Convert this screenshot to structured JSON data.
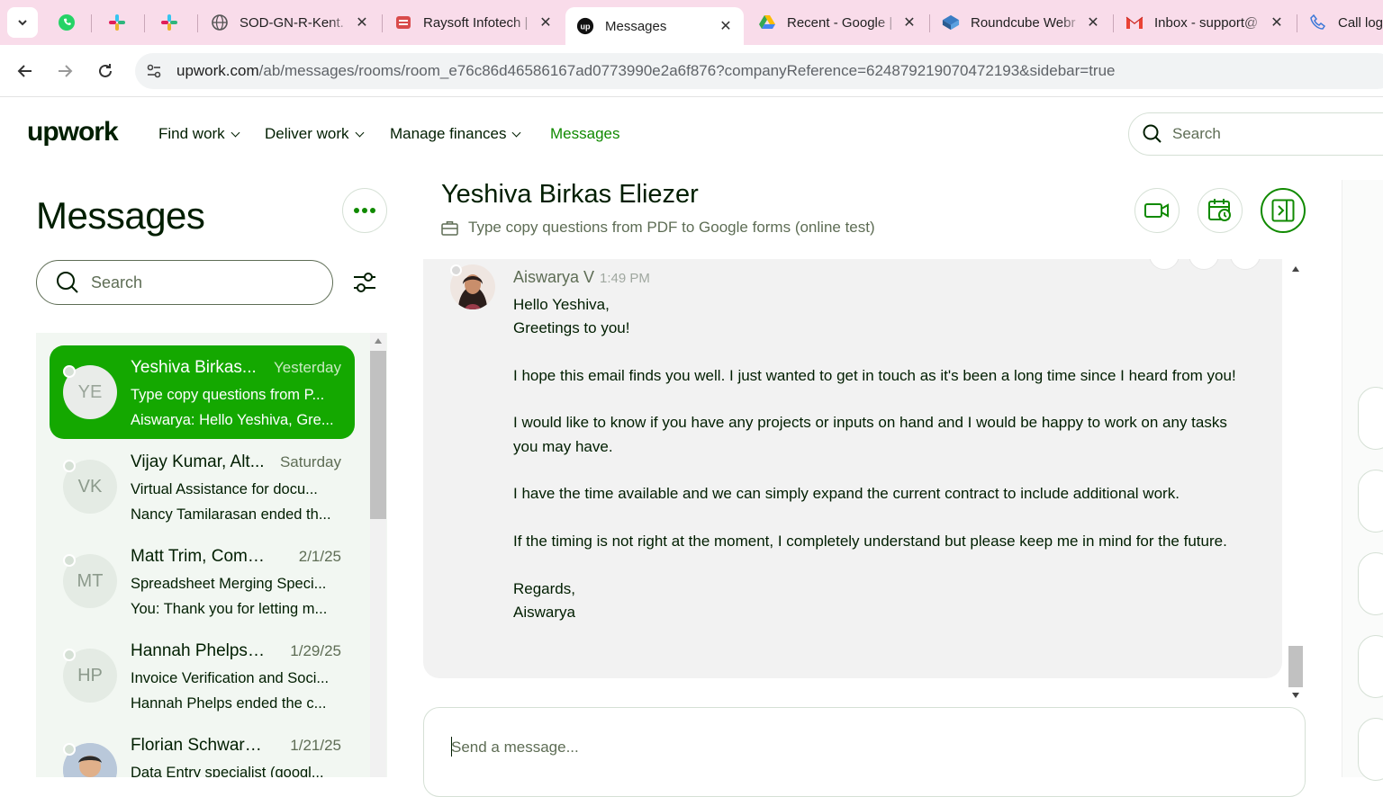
{
  "browser": {
    "tabs": [
      {
        "title": "",
        "icon": "whatsapp-icon"
      },
      {
        "title": "",
        "icon": "slack-icon"
      },
      {
        "title": "",
        "icon": "slack-icon"
      },
      {
        "title": "SOD-GN-R-Kent.",
        "icon": "globe-icon"
      },
      {
        "title": "Raysoft Infotech |",
        "icon": "raysoft-icon"
      },
      {
        "title": "Messages",
        "icon": "upwork-icon"
      },
      {
        "title": "Recent - Google |",
        "icon": "google-drive-icon"
      },
      {
        "title": "Roundcube Webr",
        "icon": "roundcube-icon"
      },
      {
        "title": "Inbox - support@",
        "icon": "gmail-icon"
      },
      {
        "title": "Call log",
        "icon": "phone-icon"
      }
    ],
    "url_host": "upwork.com",
    "url_path": "/ab/messages/rooms/room_e76c86d46586167ad0773990e2a6f876?companyReference=624879219070472193&sidebar=true",
    "tab_close": "✕"
  },
  "header": {
    "logo": "upwork",
    "nav": [
      {
        "label": "Find work",
        "dropdown": true
      },
      {
        "label": "Deliver work",
        "dropdown": true
      },
      {
        "label": "Manage finances",
        "dropdown": true
      },
      {
        "label": "Messages",
        "dropdown": false
      }
    ],
    "search_placeholder": "Search"
  },
  "sidebar": {
    "title": "Messages",
    "search_placeholder": "Search",
    "rooms": [
      {
        "initials": "YE",
        "name": "Yeshiva Birkas...",
        "date": "Yesterday",
        "line2": "Type copy questions from P...",
        "line3": "Aiswarya: Hello Yeshiva, Gre...",
        "active": true
      },
      {
        "initials": "VK",
        "name": "Vijay Kumar, Alt...",
        "date": "Saturday",
        "line2": "Virtual Assistance for docu...",
        "line3": "Nancy Tamilarasan ended th...",
        "active": false
      },
      {
        "initials": "MT",
        "name": "Matt Trim, Comm...",
        "date": "2/1/25",
        "line2": "Spreadsheet Merging Speci...",
        "line3": "You: Thank you for letting m...",
        "active": false
      },
      {
        "initials": "HP",
        "name": "Hannah Phelps, ...",
        "date": "1/29/25",
        "line2": "Invoice Verification and Soci...",
        "line3": "Hannah Phelps ended the c...",
        "active": false
      },
      {
        "initials": "",
        "name": "Florian Schwarz, ...",
        "date": "1/21/25",
        "line2": "Data Entry specialist (googl...",
        "line3": "",
        "active": false
      }
    ]
  },
  "conversation": {
    "title": "Yeshiva Birkas Eliezer",
    "subtitle": "Type copy questions from PDF to Google forms (online test)",
    "message": {
      "sender": "Aiswarya V",
      "time": "1:49 PM",
      "paragraphs": [
        "Hello Yeshiva,\nGreetings to you!",
        "I hope this email finds you well. I just wanted to get in touch as it's been a long time since I heard from you!",
        "I would like to know if you have any projects or inputs on hand and I would be happy to work on any tasks you may have.",
        "I have the time available and we can simply expand the current contract to include additional work.",
        "If the timing is not right at the moment, I completely understand but please keep me in mind for the future.",
        "Regards,\nAiswarya"
      ]
    },
    "composer_placeholder": "Send a message..."
  },
  "colors": {
    "brand_green": "#14a800",
    "tab_strip": "#f9dcea"
  }
}
